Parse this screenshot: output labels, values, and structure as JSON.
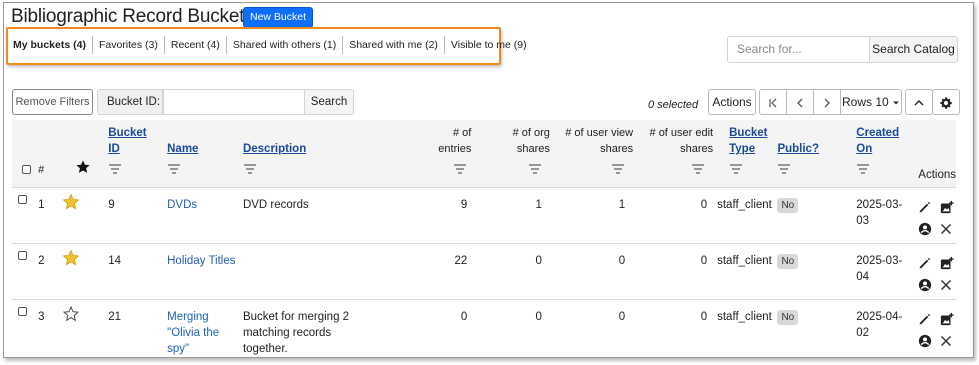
{
  "page": {
    "title": "Bibliographic Record Buckets",
    "new_bucket_label": "New Bucket"
  },
  "tabs": [
    {
      "label": "My buckets (4)",
      "active": true
    },
    {
      "label": "Favorites (3)",
      "active": false
    },
    {
      "label": "Recent (4)",
      "active": false
    },
    {
      "label": "Shared with others (1)",
      "active": false
    },
    {
      "label": "Shared with me (2)",
      "active": false
    },
    {
      "label": "Visible to me (9)",
      "active": false
    }
  ],
  "search": {
    "placeholder": "Search for...",
    "button_label": "Search Catalog"
  },
  "filters": {
    "remove_filters_label": "Remove Filters",
    "bucket_id_label": "Bucket ID:",
    "bucket_id_value": "",
    "search_label": "Search"
  },
  "toolbar": {
    "selected_text": "0 selected",
    "actions_label": "Actions",
    "first_icon": "first-page-icon",
    "prev_icon": "chevron-left-icon",
    "next_icon": "chevron-right-icon",
    "rows_label": "Rows 10",
    "collapse_icon": "chevron-up-icon",
    "settings_icon": "gear-icon"
  },
  "columns": {
    "number": "#",
    "bucket_id": "Bucket ID",
    "name": "Name",
    "description": "Description",
    "entries": "# of entries",
    "org_shares": "# of org shares",
    "user_view_shares": "# of user view shares",
    "user_edit_shares": "# of user edit shares",
    "bucket_type": "Bucket Type",
    "public": "Public?",
    "created_on": "Created On",
    "actions": "Actions"
  },
  "rows": [
    {
      "num": "1",
      "favorite": true,
      "bucket_id": "9",
      "name": "DVDs",
      "description": "DVD records",
      "entries": "9",
      "org_shares": "1",
      "user_view_shares": "1",
      "user_edit_shares": "0",
      "bucket_type": "staff_client",
      "public": "No",
      "created_on": "2025-03-03"
    },
    {
      "num": "2",
      "favorite": true,
      "bucket_id": "14",
      "name": "Holiday Titles",
      "description": "",
      "entries": "22",
      "org_shares": "0",
      "user_view_shares": "0",
      "user_edit_shares": "0",
      "bucket_type": "staff_client",
      "public": "No",
      "created_on": "2025-03-04"
    },
    {
      "num": "3",
      "favorite": false,
      "bucket_id": "21",
      "name": "Merging \"Olivia the spy\"",
      "description": "Bucket for merging 2 matching records together.",
      "entries": "0",
      "org_shares": "0",
      "user_view_shares": "0",
      "user_edit_shares": "0",
      "bucket_type": "staff_client",
      "public": "No",
      "created_on": "2025-04-02"
    }
  ],
  "colors": {
    "accent": "#0d6efd",
    "highlight_border": "#f08a1c",
    "link": "#1f5fb8",
    "star": "#f2c12e"
  }
}
